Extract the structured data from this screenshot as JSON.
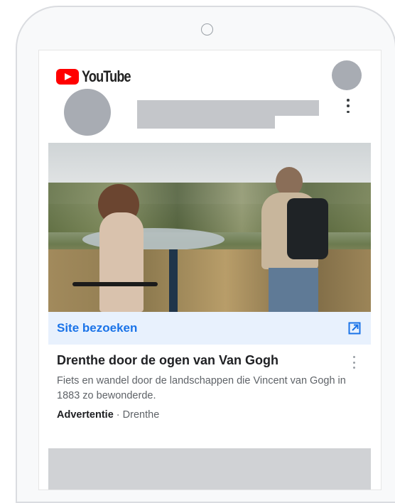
{
  "header": {
    "logo_text": "YouTube",
    "logo_icon": "youtube-play-icon"
  },
  "ad": {
    "visit_label": "Site bezoeken",
    "visit_icon": "external-link-icon",
    "title": "Drenthe door de ogen van Van Gogh",
    "description": "Fiets en wandel door de landschappen die Vincent van Gogh in 1883 zo bewonderde.",
    "badge": "Advertentie",
    "separator": " · ",
    "location": "Drenthe"
  },
  "colors": {
    "youtube_red": "#ff0000",
    "link_blue": "#1a73e8",
    "visit_bar_bg": "#e8f1fd",
    "placeholder_gray": "#c4c6ca"
  }
}
